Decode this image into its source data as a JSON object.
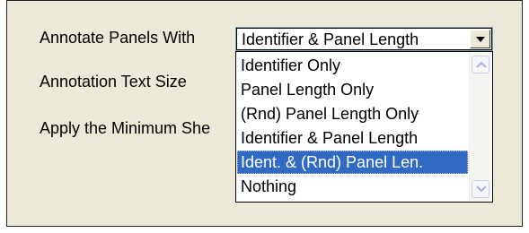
{
  "labels": {
    "annotate_panels": "Annotate Panels With",
    "annotation_text_size": "Annotation Text Size",
    "apply_min": "Apply the Minimum She"
  },
  "select": {
    "value": "Identifier & Panel Length",
    "icon": "chevron-down-icon"
  },
  "dropdown": {
    "options": [
      "Identifier Only",
      "Panel Length Only",
      "(Rnd) Panel Length Only",
      "Identifier & Panel Length",
      "Ident. & (Rnd) Panel Len.",
      "Nothing"
    ],
    "highlighted_index": 4
  },
  "colors": {
    "highlight": "#316ac5",
    "dialog_bg": "#ece9d8"
  }
}
